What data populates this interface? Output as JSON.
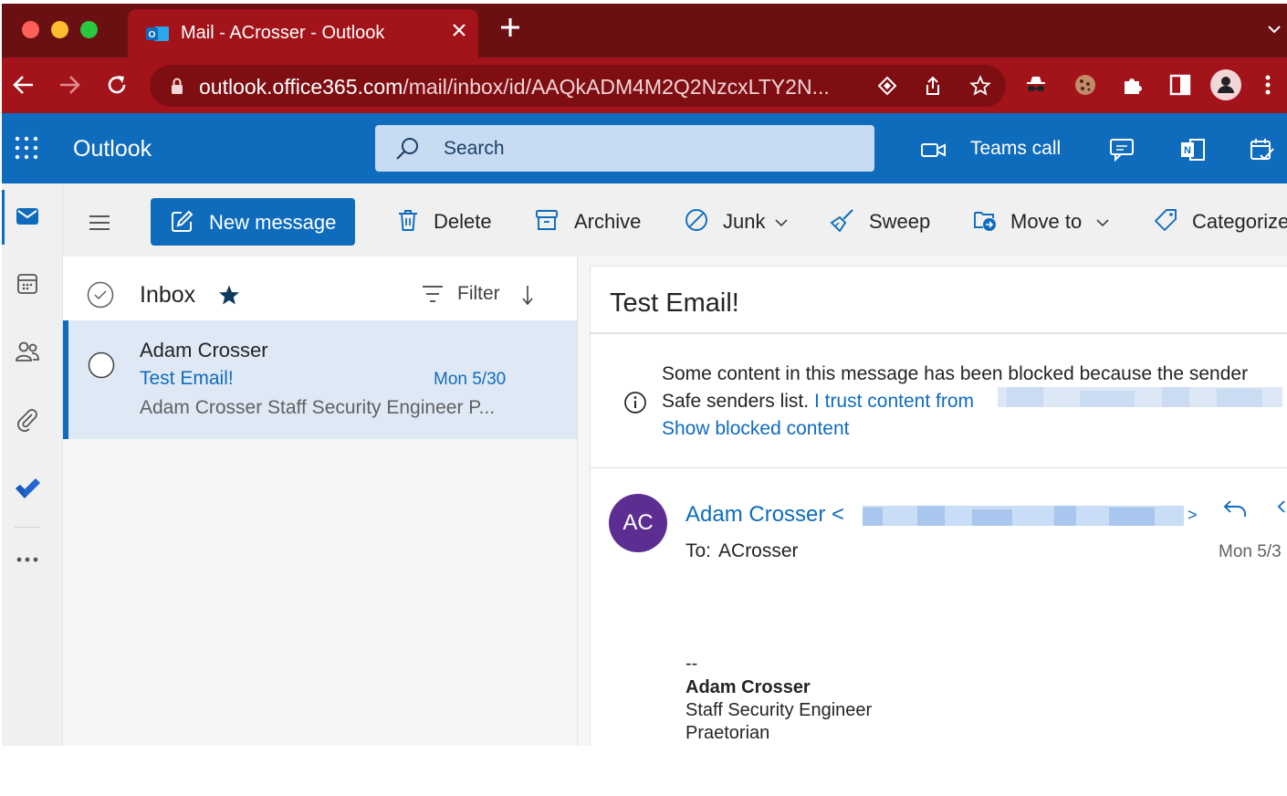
{
  "browser": {
    "tab_title": "Mail - ACrosser - Outlook",
    "url_host": "outlook.office365.com",
    "url_path": "/mail/inbox/id/AAQkADM4M2Q2NzcxLTY2N...",
    "colors": {
      "tabbar": "#6b1012",
      "toolbar": "#a3141a"
    }
  },
  "app": {
    "name": "Outlook",
    "search_placeholder": "Search",
    "teams_call": "Teams call",
    "accent": "#0f6cbd"
  },
  "commands": {
    "new_message": "New message",
    "delete": "Delete",
    "archive": "Archive",
    "junk": "Junk",
    "sweep": "Sweep",
    "move_to": "Move to",
    "categorize": "Categorize"
  },
  "list": {
    "folder": "Inbox",
    "filter": "Filter",
    "items": [
      {
        "from": "Adam Crosser",
        "subject": "Test Email!",
        "date": "Mon 5/30",
        "preview": "Adam Crosser Staff Security Engineer P..."
      }
    ]
  },
  "message": {
    "subject": "Test Email!",
    "banner_line1": "Some content in this message has been blocked because the sender",
    "banner_line2": "Safe senders list.",
    "banner_trust_link": "I trust content from",
    "banner_show_link": "Show blocked content",
    "avatar_initials": "AC",
    "avatar_color": "#5c2e91",
    "sender_name": "Adam Crosser",
    "to_label": "To:",
    "to_value": "ACrosser",
    "date": "Mon 5/3",
    "signature": {
      "dashes": "--",
      "name": "Adam Crosser",
      "title": "Staff Security Engineer",
      "company": "Praetorian"
    }
  }
}
